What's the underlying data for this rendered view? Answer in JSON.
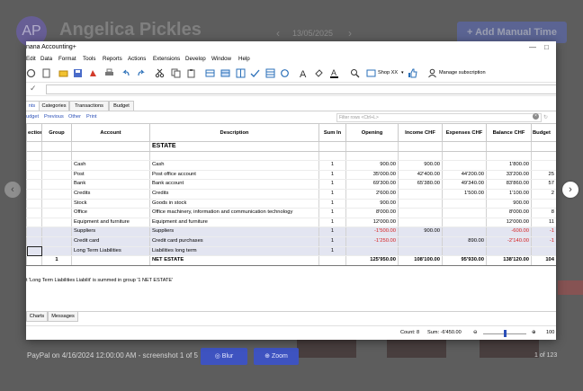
{
  "background": {
    "avatar_initials": "AP",
    "user_name": "Angelica Pickles",
    "date": "13/05/2025",
    "add_button": "Add Manual Time"
  },
  "lightbox": {
    "caption": "PayPal on 4/16/2024 12:00:00 AM - screenshot 1 of 5",
    "blur_label": "Blur",
    "zoom_label": "Zoom",
    "count": "1 of 123"
  },
  "window": {
    "title": "nana Accounting+",
    "menu": [
      "Edit",
      "Data",
      "Format",
      "Tools",
      "Reports",
      "Actions",
      "Extensions",
      "Develop",
      "Window",
      "Help"
    ],
    "toolbar": {
      "shop_label": "Shop XX",
      "manage_subscription": "Manage subscription"
    },
    "tabs": [
      "nts",
      "Categories",
      "Transactions",
      "Budget"
    ],
    "views": [
      "udget",
      "Previous",
      "Other",
      "Print"
    ],
    "filter_placeholder": "Filter rows <Ctrl+L>",
    "columns": [
      "ection",
      "Group",
      "Account",
      "Description",
      "Sum In",
      "Opening",
      "Income CHF",
      "Expenses CHF",
      "Balance CHF",
      "Budget"
    ],
    "section_title": "ESTATE",
    "rows": [
      {
        "group": "",
        "account": "Cash",
        "desc": "Cash",
        "sumin": "1",
        "opening": "900.00",
        "income": "900.00",
        "expenses": "",
        "balance": "1'800.00",
        "budget": "",
        "neg": false,
        "sub": false
      },
      {
        "group": "",
        "account": "Post",
        "desc": "Post office account",
        "sumin": "1",
        "opening": "35'000.00",
        "income": "42'400.00",
        "expenses": "44'200.00",
        "balance": "33'200.00",
        "budget": "25",
        "neg": false,
        "sub": false
      },
      {
        "group": "",
        "account": "Bank",
        "desc": "Bank account",
        "sumin": "1",
        "opening": "69'300.00",
        "income": "65'380.00",
        "expenses": "49'340.00",
        "balance": "83'860.00",
        "budget": "57",
        "neg": false,
        "sub": false
      },
      {
        "group": "",
        "account": "Credits",
        "desc": "Credits",
        "sumin": "1",
        "opening": "2'600.00",
        "income": "",
        "expenses": "1'500.00",
        "balance": "1'100.00",
        "budget": "2",
        "neg": false,
        "sub": false
      },
      {
        "group": "",
        "account": "Stock",
        "desc": "Goods in stock",
        "sumin": "1",
        "opening": "900.00",
        "income": "",
        "expenses": "",
        "balance": "900.00",
        "budget": "",
        "neg": false,
        "sub": false
      },
      {
        "group": "",
        "account": "Office",
        "desc": "Office machinery, information and communication technology",
        "sumin": "1",
        "opening": "8'000.00",
        "income": "",
        "expenses": "",
        "balance": "8'000.00",
        "budget": "8",
        "neg": false,
        "sub": false
      },
      {
        "group": "",
        "account": "Equipment and furniture",
        "desc": "Equipment and furniture",
        "sumin": "1",
        "opening": "12'000.00",
        "income": "",
        "expenses": "",
        "balance": "12'000.00",
        "budget": "11",
        "neg": false,
        "sub": false
      },
      {
        "group": "",
        "account": "Suppliers",
        "desc": "Suppliers",
        "sumin": "1",
        "opening": "-1'500.00",
        "income": "900.00",
        "expenses": "",
        "balance": "-600.00",
        "budget": "-1",
        "neg": true,
        "sub": true
      },
      {
        "group": "",
        "account": "Credit card",
        "desc": "Credit card purchases",
        "sumin": "1",
        "opening": "-1'250.00",
        "income": "",
        "expenses": "890.00",
        "balance": "-2'140.00",
        "budget": "-1",
        "neg": true,
        "sub": true
      },
      {
        "group": "",
        "account": "Long Term Liabilities",
        "desc": "Liabilities long term",
        "sumin": "1",
        "opening": "",
        "income": "",
        "expenses": "",
        "balance": "",
        "budget": "",
        "neg": false,
        "sub": true
      }
    ],
    "total": {
      "group": "1",
      "desc": "NET ESTATE",
      "opening": "125'950.00",
      "income": "108'100.00",
      "expenses": "95'930.00",
      "balance": "138'120.00",
      "budget": "104"
    },
    "message": "t 'Long Term Liabilities Liabilit' is summed in group '1 NET ESTATE'",
    "bottom_tabs": [
      "Charts",
      "Messages"
    ],
    "status_count": "Count: 8",
    "status_sum": "Sum: -6'450.00",
    "zoom_value": "100"
  }
}
